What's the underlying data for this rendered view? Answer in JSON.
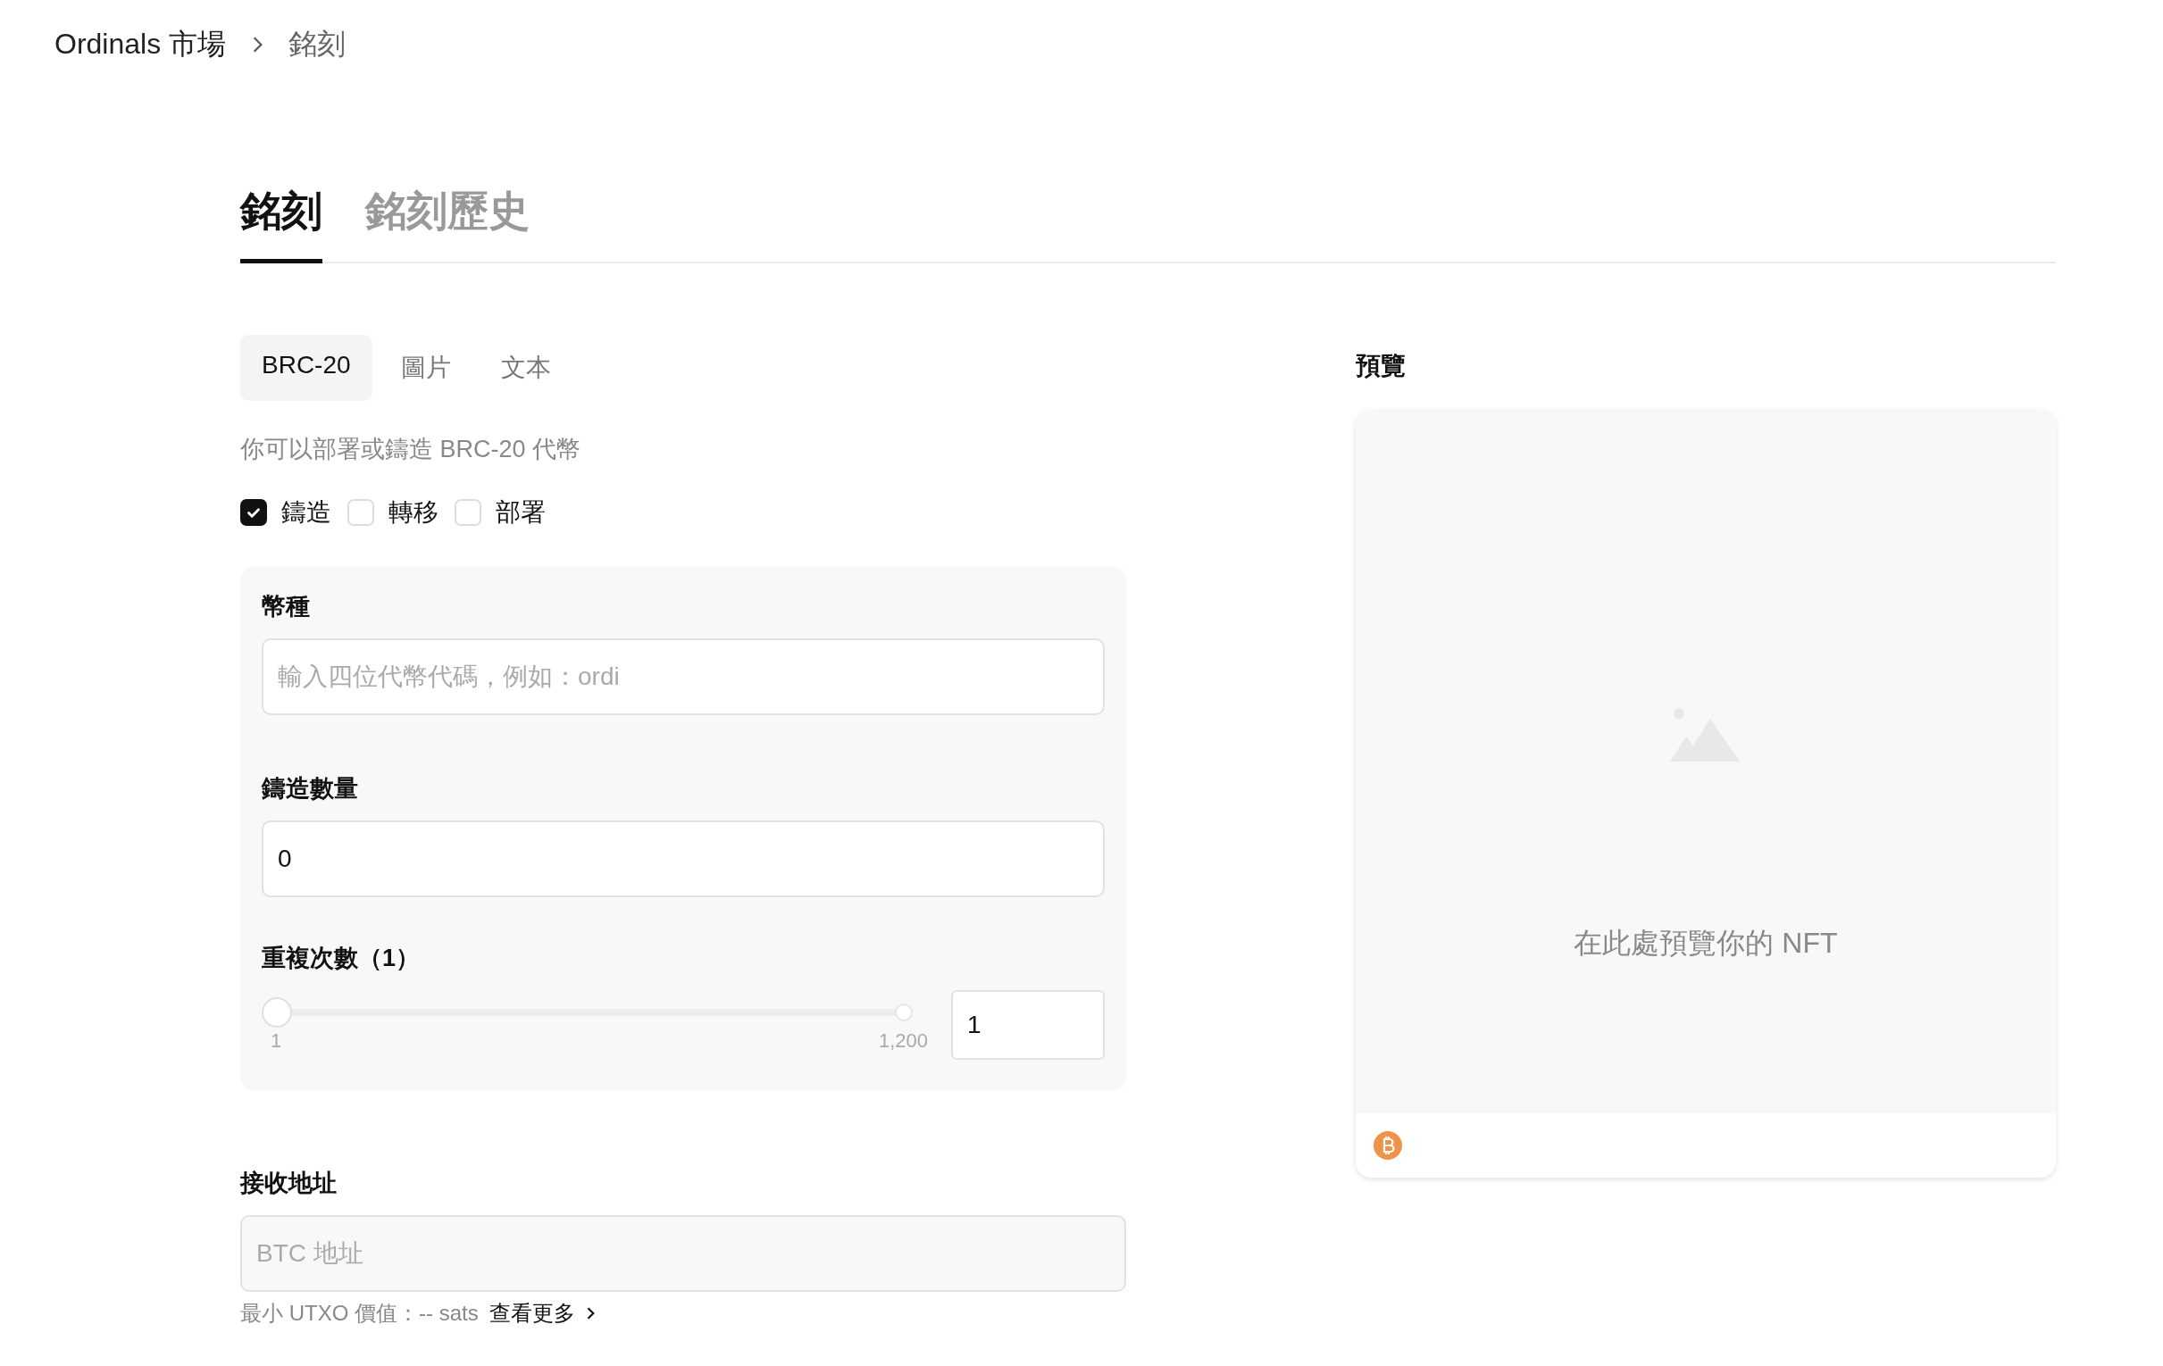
{
  "breadcrumb": [
    {
      "label": "Ordinals 市場"
    },
    {
      "label": "銘刻"
    }
  ],
  "tabs": [
    {
      "label": "銘刻",
      "selected": true
    },
    {
      "label": "銘刻歷史",
      "selected": false
    }
  ],
  "type_tabs": [
    {
      "label": "BRC-20",
      "selected": true
    },
    {
      "label": "圖片",
      "selected": false
    },
    {
      "label": "文本",
      "selected": false
    }
  ],
  "description": "你可以部署或鑄造 BRC-20 代幣",
  "operations": [
    {
      "label": "鑄造",
      "checked": true
    },
    {
      "label": "轉移",
      "checked": false
    },
    {
      "label": "部署",
      "checked": false
    }
  ],
  "form": {
    "ticker": {
      "label": "幣種",
      "placeholder": "輸入四位代幣代碼，例如：ordi"
    },
    "amount": {
      "label": "鑄造數量",
      "value": "0"
    },
    "repeat": {
      "label": "重複次數（1）",
      "level": 0,
      "min": "1",
      "max": "1,200",
      "value": "1"
    }
  },
  "address": {
    "label": "接收地址",
    "placeholder": "BTC 地址",
    "hint": "最小 UTXO 價值：-- sats",
    "link": "查看更多"
  },
  "preview": {
    "title": "預覽",
    "message": "在此處預覽你的 NFT"
  }
}
